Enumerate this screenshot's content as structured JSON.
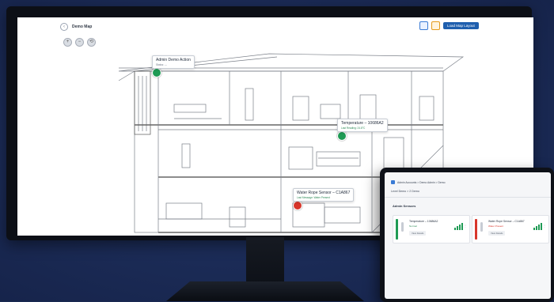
{
  "monitor": {
    "back_icon": "circle-left-icon",
    "map_title": "Demo Map",
    "zoom_icons": [
      "zoom-in-icon",
      "zoom-out-icon",
      "reset-view-icon"
    ],
    "load_button": "Load Map Layout",
    "sensors": [
      {
        "title": "Admin Demo Action",
        "subtitle": "Status: ---",
        "status": "green"
      },
      {
        "title": "Temperature – 10686A2",
        "subtitle": "Last Reading: 24.8°C",
        "status": "green"
      },
      {
        "title": "Water Rope Sensor – C1A867",
        "subtitle": "Last Message: Water Present",
        "status": "red"
      }
    ]
  },
  "tablet": {
    "breadcrumb": "Admin Accounts > Demo Admin > Demo",
    "level": "Level   Demo > 2 Demo",
    "section_title": "Admin Sensors",
    "cards": [
      {
        "title": "Temperature – 10686A2",
        "status_text": "Normal",
        "button": "View Details",
        "status": "green"
      },
      {
        "title": "Water Rope Sensor – C1A867",
        "status_text": "Water Present",
        "button": "View Details",
        "status": "red"
      }
    ]
  },
  "colors": {
    "background": "#1a2a52",
    "accent": "#1f5fae",
    "ok": "#1f9b55",
    "alert": "#d8362b"
  }
}
